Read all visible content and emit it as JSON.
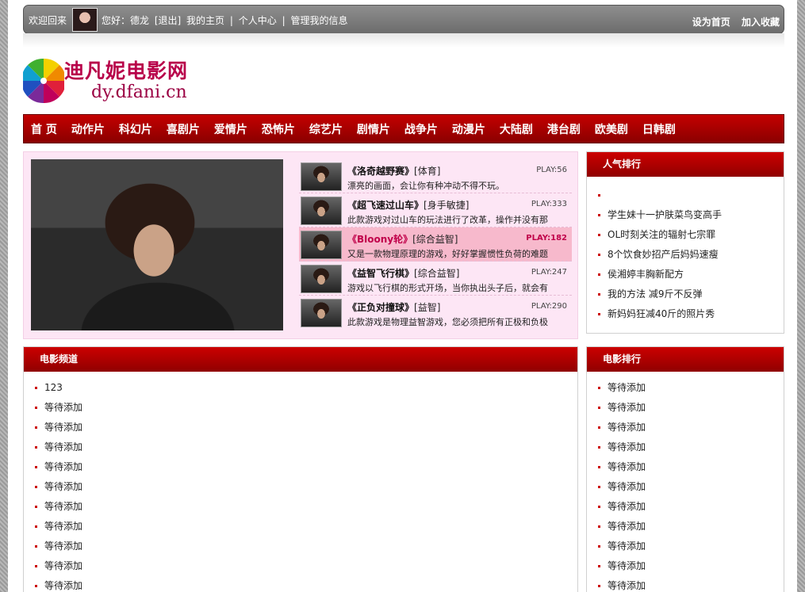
{
  "topbar": {
    "welcome": "欢迎回来",
    "greeting": "您好：德龙",
    "logout": "[退出]",
    "home": "我的主页",
    "sep1": "|",
    "center": "个人中心",
    "sep2": "|",
    "manage": "管理我的信息",
    "set_home": "设为首页",
    "favorite": "加入收藏"
  },
  "logo": {
    "brand": "迪凡妮电影网",
    "domain": "dy.dfani.cn"
  },
  "nav": [
    "首 页",
    "动作片",
    "科幻片",
    "喜剧片",
    "爱情片",
    "恐怖片",
    "综艺片",
    "剧情片",
    "战争片",
    "动漫片",
    "大陆剧",
    "港台剧",
    "欧美剧",
    "日韩剧"
  ],
  "featured": [
    {
      "title": "《洛奇越野赛》",
      "tag": "[体育]",
      "play": "PLAY:56",
      "desc": "漂亮的画面，会让你有种冲动不得不玩。"
    },
    {
      "title": "《超飞速过山车》",
      "tag": "[身手敏捷]",
      "play": "PLAY:333",
      "desc": "此款游戏对过山车的玩法进行了改革，操作并没有那"
    },
    {
      "title": "《Bloony轮》",
      "tag": "[综合益智]",
      "play": "PLAY:182",
      "desc": "又是一款物理原理的游戏，好好掌握惯性负荷的难题"
    },
    {
      "title": "《益智飞行棋》",
      "tag": "[综合益智]",
      "play": "PLAY:247",
      "desc": "游戏以飞行棋的形式开场，当你执出头子后，就会有"
    },
    {
      "title": "《正负对撞球》",
      "tag": "[益智]",
      "play": "PLAY:290",
      "desc": "此款游戏是物理益智游戏，您必须把所有正极和负极"
    }
  ],
  "popular": {
    "title": "人气排行",
    "items": [
      "",
      "学生妹十一护肤菜鸟变高手",
      "OL时刻关注的辐射七宗罪",
      "8个饮食妙招产后妈妈速瘦",
      "侯湘婷丰胸新配方",
      "我的方法 减9斤不反弹",
      "新妈妈狂减40斤的照片秀"
    ]
  },
  "channel": {
    "title": "电影频道",
    "items": [
      "123",
      "等待添加",
      "等待添加",
      "等待添加",
      "等待添加",
      "等待添加",
      "等待添加",
      "等待添加",
      "等待添加",
      "等待添加",
      "等待添加"
    ]
  },
  "ranking": {
    "title": "电影排行",
    "items": [
      "等待添加",
      "等待添加",
      "等待添加",
      "等待添加",
      "等待添加",
      "等待添加",
      "等待添加",
      "等待添加",
      "等待添加",
      "等待添加",
      "等待添加"
    ]
  }
}
